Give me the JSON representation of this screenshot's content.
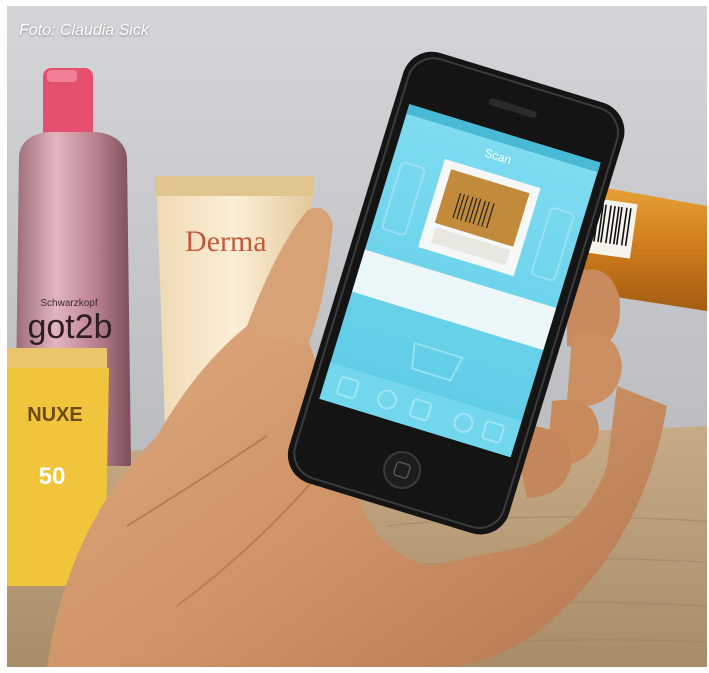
{
  "photo": {
    "credit": "Foto: Claudia Sick",
    "description": "Hand holding a smartphone running a barcode scanning app, pointed at a sunscreen tube; sunscreen bottles in the background"
  },
  "products": {
    "spray_brand": "Schwarzkopf",
    "spray_name": "got2b",
    "tube_brand": "Derma",
    "nuxe_brand": "NUXE",
    "nuxe_spf": "50"
  },
  "phone_screen": {
    "app_title": "Scan",
    "accent_color": "#67d3ea"
  },
  "colors": {
    "wall": "#c8c9cc",
    "table": "#b59a77",
    "skin": "#d19b6e",
    "phone_body": "#141414"
  }
}
